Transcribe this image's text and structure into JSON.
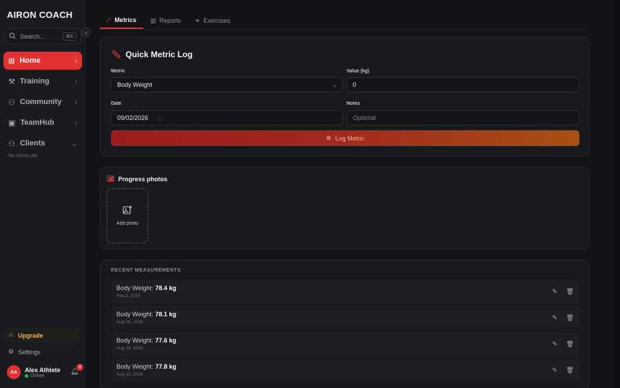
{
  "brand": {
    "logo_text": "AIRON COACH"
  },
  "sidebar": {
    "search_placeholder": "Search...",
    "search_shortcut": "⌘K",
    "collapse_icon": "‹",
    "items": [
      {
        "label": "Home",
        "icon": "home-icon",
        "glyph": "⊞",
        "active": true
      },
      {
        "label": "Training",
        "icon": "dumbbell-icon",
        "glyph": "⚒"
      },
      {
        "label": "Community",
        "icon": "users-icon",
        "glyph": "⚇"
      },
      {
        "label": "TeamHub",
        "icon": "team-icon",
        "glyph": "▣"
      },
      {
        "label": "Clients",
        "icon": "clients-icon",
        "glyph": "⚇"
      }
    ],
    "clients_empty": "No clients yet",
    "upgrade_label": "Upgrade",
    "settings_label": "Settings",
    "user": {
      "initials": "AA",
      "name": "Alex Athlete",
      "status": "Online",
      "notifications": "1"
    }
  },
  "tabs": [
    {
      "label": "Metrics",
      "icon": "chart-line-icon",
      "glyph": "⟋",
      "active": true
    },
    {
      "label": "Reports",
      "icon": "bar-chart-icon",
      "glyph": "▥"
    },
    {
      "label": "Exercises",
      "icon": "exercises-icon",
      "glyph": "⚭"
    }
  ],
  "quick_log": {
    "title": "Quick Metric Log",
    "metric_label": "Metric",
    "metric_value": "Body Weight",
    "value_label": "Value (kg)",
    "value_value": "0",
    "date_label": "Date",
    "date_value": "09/02/2026",
    "notes_label": "Notes",
    "notes_placeholder": "Optional",
    "button_label": "Log Metric"
  },
  "photos": {
    "title": "Progress photos",
    "add_label": "Add photo"
  },
  "measurements": {
    "title": "RECENT MEASUREMENTS",
    "rows": [
      {
        "label": "Body Weight:",
        "value": "78.4 kg",
        "date": "Sep 2, 2026"
      },
      {
        "label": "Body Weight:",
        "value": "78.1 kg",
        "date": "Aug 26, 2026"
      },
      {
        "label": "Body Weight:",
        "value": "77.6 kg",
        "date": "Aug 19, 2026"
      },
      {
        "label": "Body Weight:",
        "value": "77.8 kg",
        "date": "Aug 12, 2026"
      }
    ]
  },
  "colors": {
    "accent": "#e43232",
    "upgrade": "#f4b43a",
    "online": "#22c55e"
  }
}
